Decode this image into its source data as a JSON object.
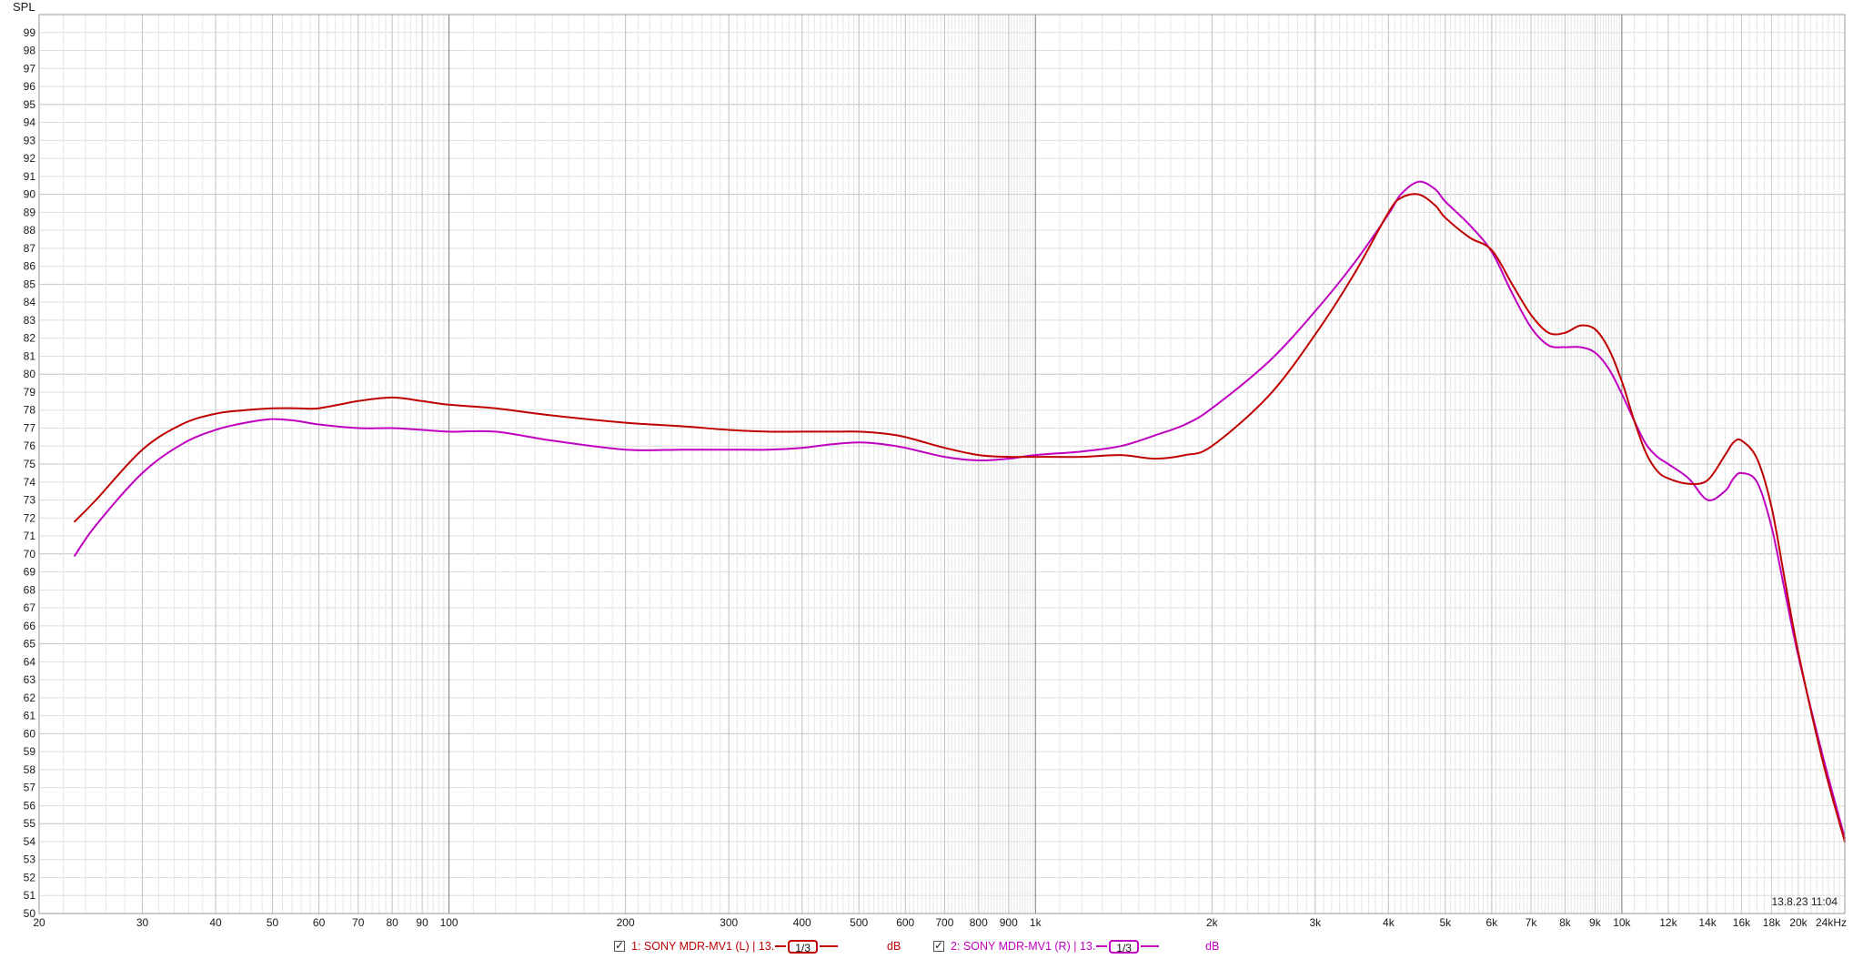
{
  "chart_data": {
    "type": "line",
    "ylabel": "SPL",
    "xunit": "kHz",
    "x_scale": "log",
    "xlim": [
      20,
      24000
    ],
    "ylim": [
      50,
      100
    ],
    "grid": true,
    "legend_position": "bottom",
    "timestamp": "13.8.23 11:04",
    "x_major_ticks": [
      {
        "value": 20,
        "label": "20"
      },
      {
        "value": 30,
        "label": "30"
      },
      {
        "value": 40,
        "label": "40"
      },
      {
        "value": 50,
        "label": "50"
      },
      {
        "value": 60,
        "label": "60"
      },
      {
        "value": 70,
        "label": "70"
      },
      {
        "value": 80,
        "label": "80"
      },
      {
        "value": 90,
        "label": "90"
      },
      {
        "value": 100,
        "label": "100"
      },
      {
        "value": 200,
        "label": "200"
      },
      {
        "value": 300,
        "label": "300"
      },
      {
        "value": 400,
        "label": "400"
      },
      {
        "value": 500,
        "label": "500"
      },
      {
        "value": 600,
        "label": "600"
      },
      {
        "value": 700,
        "label": "700"
      },
      {
        "value": 800,
        "label": "800"
      },
      {
        "value": 900,
        "label": "900"
      },
      {
        "value": 1000,
        "label": "1k"
      },
      {
        "value": 2000,
        "label": "2k"
      },
      {
        "value": 3000,
        "label": "3k"
      },
      {
        "value": 4000,
        "label": "4k"
      },
      {
        "value": 5000,
        "label": "5k"
      },
      {
        "value": 6000,
        "label": "6k"
      },
      {
        "value": 7000,
        "label": "7k"
      },
      {
        "value": 8000,
        "label": "8k"
      },
      {
        "value": 9000,
        "label": "9k"
      },
      {
        "value": 10000,
        "label": "10k"
      },
      {
        "value": 24000,
        "label": "24kHz"
      }
    ],
    "x_minor_ticks": [
      {
        "value": 12000,
        "label": "12k"
      },
      {
        "value": 14000,
        "label": "14k"
      },
      {
        "value": 16000,
        "label": "16k"
      },
      {
        "value": 18000,
        "label": "18k"
      },
      {
        "value": 20000,
        "label": "20k"
      }
    ],
    "series": [
      {
        "name": "1: SONY MDR-MV1 (L) | 13.",
        "smoothing": "1/3",
        "unit": "dB",
        "color": "#c00000",
        "x": [
          23,
          25,
          30,
          35,
          40,
          45,
          50,
          55,
          60,
          70,
          80,
          90,
          100,
          120,
          150,
          200,
          250,
          300,
          350,
          400,
          450,
          500,
          550,
          600,
          700,
          800,
          900,
          1000,
          1200,
          1400,
          1600,
          1800,
          2000,
          2500,
          3000,
          3500,
          4000,
          4200,
          4500,
          4800,
          5000,
          5500,
          6000,
          6500,
          7000,
          7500,
          8000,
          8500,
          9000,
          9500,
          10000,
          10500,
          11000,
          11500,
          12000,
          13000,
          14000,
          15000,
          15500,
          16000,
          17000,
          18000,
          19000,
          20000,
          22000,
          24000
        ],
        "y": [
          71.8,
          73.0,
          75.8,
          77.2,
          77.8,
          78.0,
          78.1,
          78.1,
          78.1,
          78.5,
          78.7,
          78.5,
          78.3,
          78.1,
          77.7,
          77.3,
          77.1,
          76.9,
          76.8,
          76.8,
          76.8,
          76.8,
          76.7,
          76.5,
          75.9,
          75.5,
          75.4,
          75.4,
          75.4,
          75.5,
          75.3,
          75.5,
          76.0,
          78.8,
          82.2,
          85.6,
          89.0,
          89.8,
          90.0,
          89.4,
          88.7,
          87.6,
          86.9,
          85.0,
          83.3,
          82.3,
          82.3,
          82.7,
          82.5,
          81.4,
          79.6,
          77.4,
          75.6,
          74.6,
          74.2,
          73.9,
          74.1,
          75.5,
          76.2,
          76.3,
          75.3,
          72.6,
          68.4,
          64.5,
          58.5,
          54.0
        ]
      },
      {
        "name": "2: SONY MDR-MV1 (R) | 13.",
        "smoothing": "1/3",
        "unit": "dB",
        "color": "#c000c0",
        "x": [
          23,
          25,
          30,
          35,
          40,
          45,
          50,
          55,
          60,
          70,
          80,
          90,
          100,
          120,
          150,
          200,
          250,
          300,
          350,
          400,
          450,
          500,
          550,
          600,
          700,
          800,
          900,
          1000,
          1200,
          1400,
          1600,
          1800,
          2000,
          2500,
          3000,
          3500,
          4000,
          4200,
          4500,
          4800,
          5000,
          5500,
          6000,
          6500,
          7000,
          7500,
          8000,
          8500,
          9000,
          9500,
          10000,
          10500,
          11000,
          11500,
          12000,
          13000,
          14000,
          15000,
          15500,
          16000,
          17000,
          18000,
          19000,
          20000,
          22000,
          24000
        ],
        "y": [
          69.9,
          71.6,
          74.5,
          76.1,
          76.9,
          77.3,
          77.5,
          77.4,
          77.2,
          77.0,
          77.0,
          76.9,
          76.8,
          76.8,
          76.3,
          75.8,
          75.8,
          75.8,
          75.8,
          75.9,
          76.1,
          76.2,
          76.1,
          75.9,
          75.4,
          75.2,
          75.3,
          75.5,
          75.7,
          76.0,
          76.6,
          77.2,
          78.1,
          80.7,
          83.5,
          86.2,
          88.9,
          90.0,
          90.7,
          90.3,
          89.6,
          88.3,
          86.8,
          84.5,
          82.6,
          81.6,
          81.5,
          81.5,
          81.2,
          80.3,
          78.9,
          77.4,
          76.1,
          75.4,
          75.0,
          74.2,
          73.0,
          73.5,
          74.2,
          74.5,
          74.0,
          71.5,
          67.8,
          64.3,
          58.8,
          54.2
        ]
      }
    ]
  }
}
